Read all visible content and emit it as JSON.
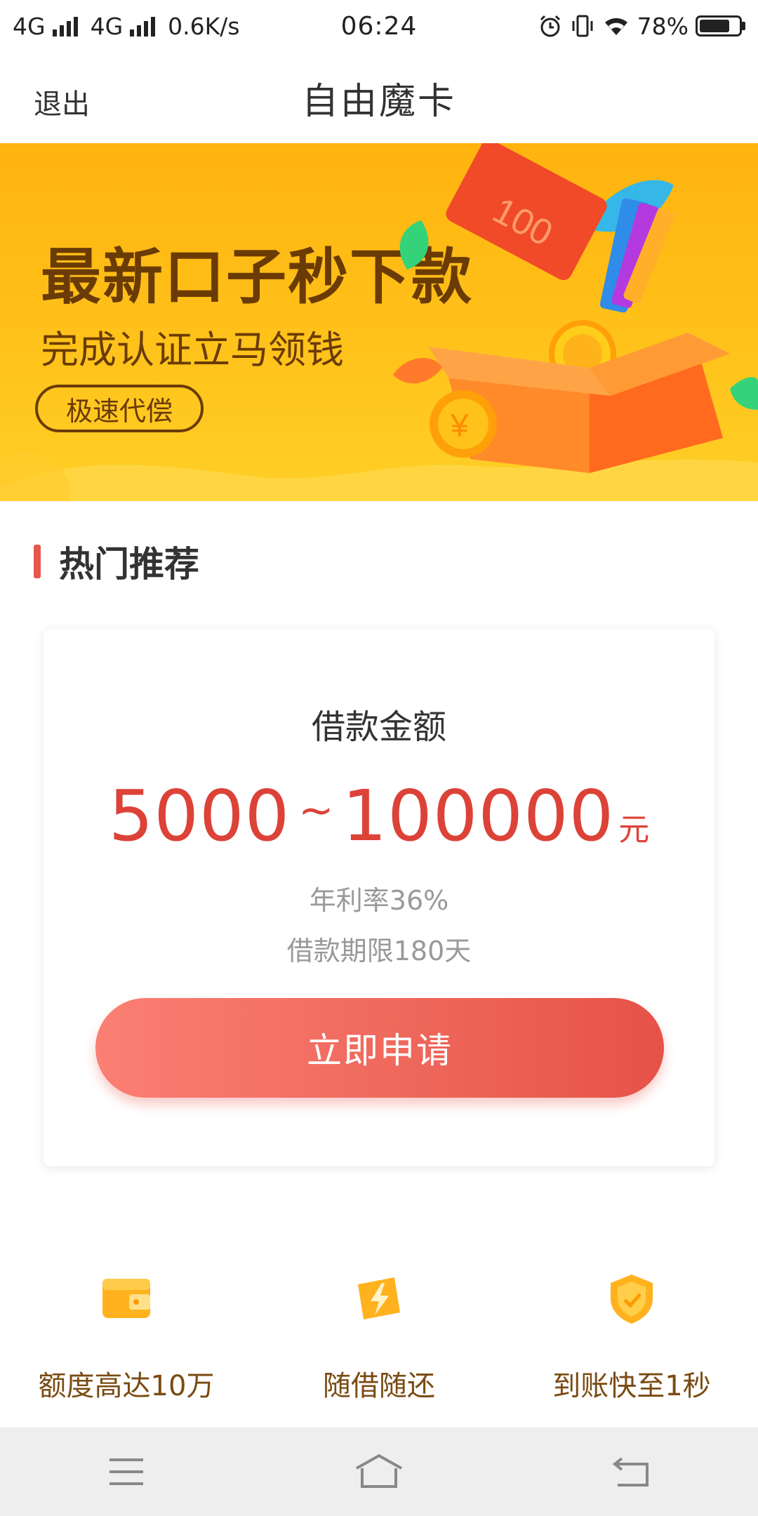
{
  "status_bar": {
    "network1": "4G",
    "network2": "4G",
    "speed": "0.6K/s",
    "time": "06:24",
    "battery": "78%",
    "battery_level": 0.78
  },
  "header": {
    "exit_label": "退出",
    "title": "自由魔卡"
  },
  "banner": {
    "headline": "最新口子秒下款",
    "subline": "完成认证立马领钱",
    "pill_label": "极速代偿",
    "art_note_value": "100",
    "art_coin_symbol": "¥"
  },
  "section": {
    "title": "热门推荐",
    "accent_color": "#e8564a"
  },
  "product": {
    "amount_label": "借款金额",
    "amount_min": "5000",
    "amount_separator": "~",
    "amount_max": "100000",
    "amount_unit": "元",
    "rate": "年利率36%",
    "term": "借款期限180天",
    "apply_label": "立即申请",
    "amount_color": "#dc4238"
  },
  "features": [
    {
      "icon": "wallet-icon",
      "label": "额度高达10万"
    },
    {
      "icon": "lightning-icon",
      "label": "随借随还"
    },
    {
      "icon": "shield-icon",
      "label": "到账快至1秒"
    }
  ],
  "nav": {
    "menu_icon": "menu-icon",
    "home_icon": "home-icon",
    "back_icon": "back-icon"
  }
}
